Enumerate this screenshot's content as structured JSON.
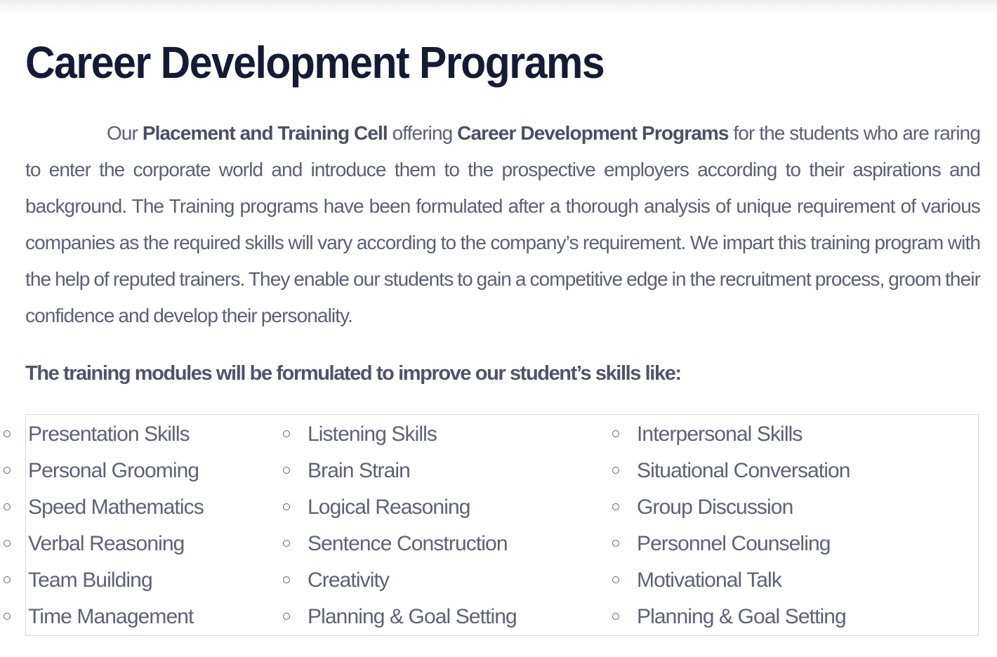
{
  "page": {
    "title": "Career Development Programs"
  },
  "intro": {
    "t1": "Our ",
    "b1": "Placement and Training Cell",
    "t2": " offering ",
    "b2": "Career Development Programs",
    "t3": " for the students who are raring to enter the corporate world and introduce them to the prospective employers according to their aspirations and background. The Training programs have been formulated after a thorough analysis of unique requirement of various companies as the required skills will vary according to the company’s requirement. We impart this training program with the help of reputed trainers. They enable our students to gain a competitive edge in the recruitment process, groom their confidence and develop their personality."
  },
  "modules": {
    "heading": "The training modules will be formulated to improve our student’s skills like:",
    "columns": [
      [
        "Presentation Skills",
        "Personal Grooming",
        "Speed Mathematics",
        "Verbal Reasoning",
        "Team Building",
        "Time Management"
      ],
      [
        "Listening Skills",
        "Brain Strain",
        "Logical Reasoning",
        "Sentence Construction",
        "Creativity",
        "Planning & Goal Setting"
      ],
      [
        "Interpersonal Skills",
        "Situational Conversation",
        "Group Discussion",
        "Personnel Counseling",
        "Motivational Talk",
        "Planning & Goal Setting"
      ]
    ]
  },
  "colors": {
    "title": "#141b35",
    "body_text": "#5b6073",
    "box_border": "#d9d9d9"
  },
  "icons": {
    "bullet": "hollow-circle-bullet"
  }
}
